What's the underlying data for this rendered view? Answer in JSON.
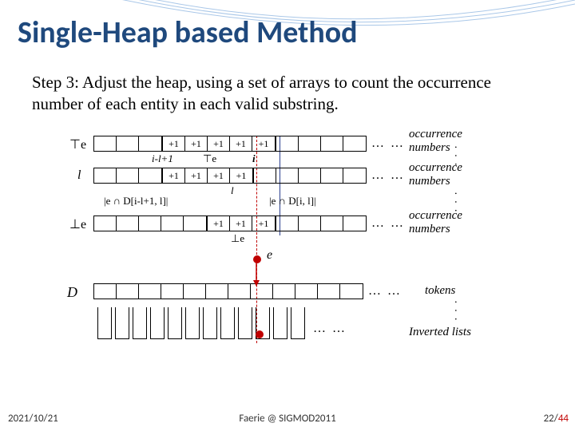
{
  "title": "Single-Heap based Method",
  "body": "Step 3: Adjust the heap, using a set of arrays to count the occurrence number of  each entity in each valid substring.",
  "rows": {
    "rTopLabel": "⊤e",
    "rTopVals": [
      "+1",
      "+1",
      "+1",
      "+1",
      "+1"
    ],
    "rTopRight": "occurrence numbers",
    "rTopSmallLeft": "i-l+1",
    "rTopSmallMid": "⊤e",
    "rTopSmallRight": "i",
    "rLLabel": "l",
    "rLVals": [
      "+1",
      "+1",
      "+1",
      "+1"
    ],
    "rLRight": "occurrence numbers",
    "rLSmallMid": "l",
    "rBraceLeft": "|e ∩ D[i-l+1, l]|",
    "rBraceRight": "|e ∩ D[i, l]|",
    "rBotLabel": "⊥e",
    "rBotVals": [
      "+1",
      "+1",
      "+1"
    ],
    "rBotRight": "occurrence numbers",
    "rBotSmallMid": "⊥e",
    "eLabel": "e",
    "DLabel": "D",
    "tokensLabel": "tokens",
    "invLabel": "Inverted lists"
  },
  "footer": {
    "date": "2021/10/21",
    "center": "Faerie @ SIGMOD2011",
    "page": "22",
    "total": "44"
  },
  "dots": "… …"
}
